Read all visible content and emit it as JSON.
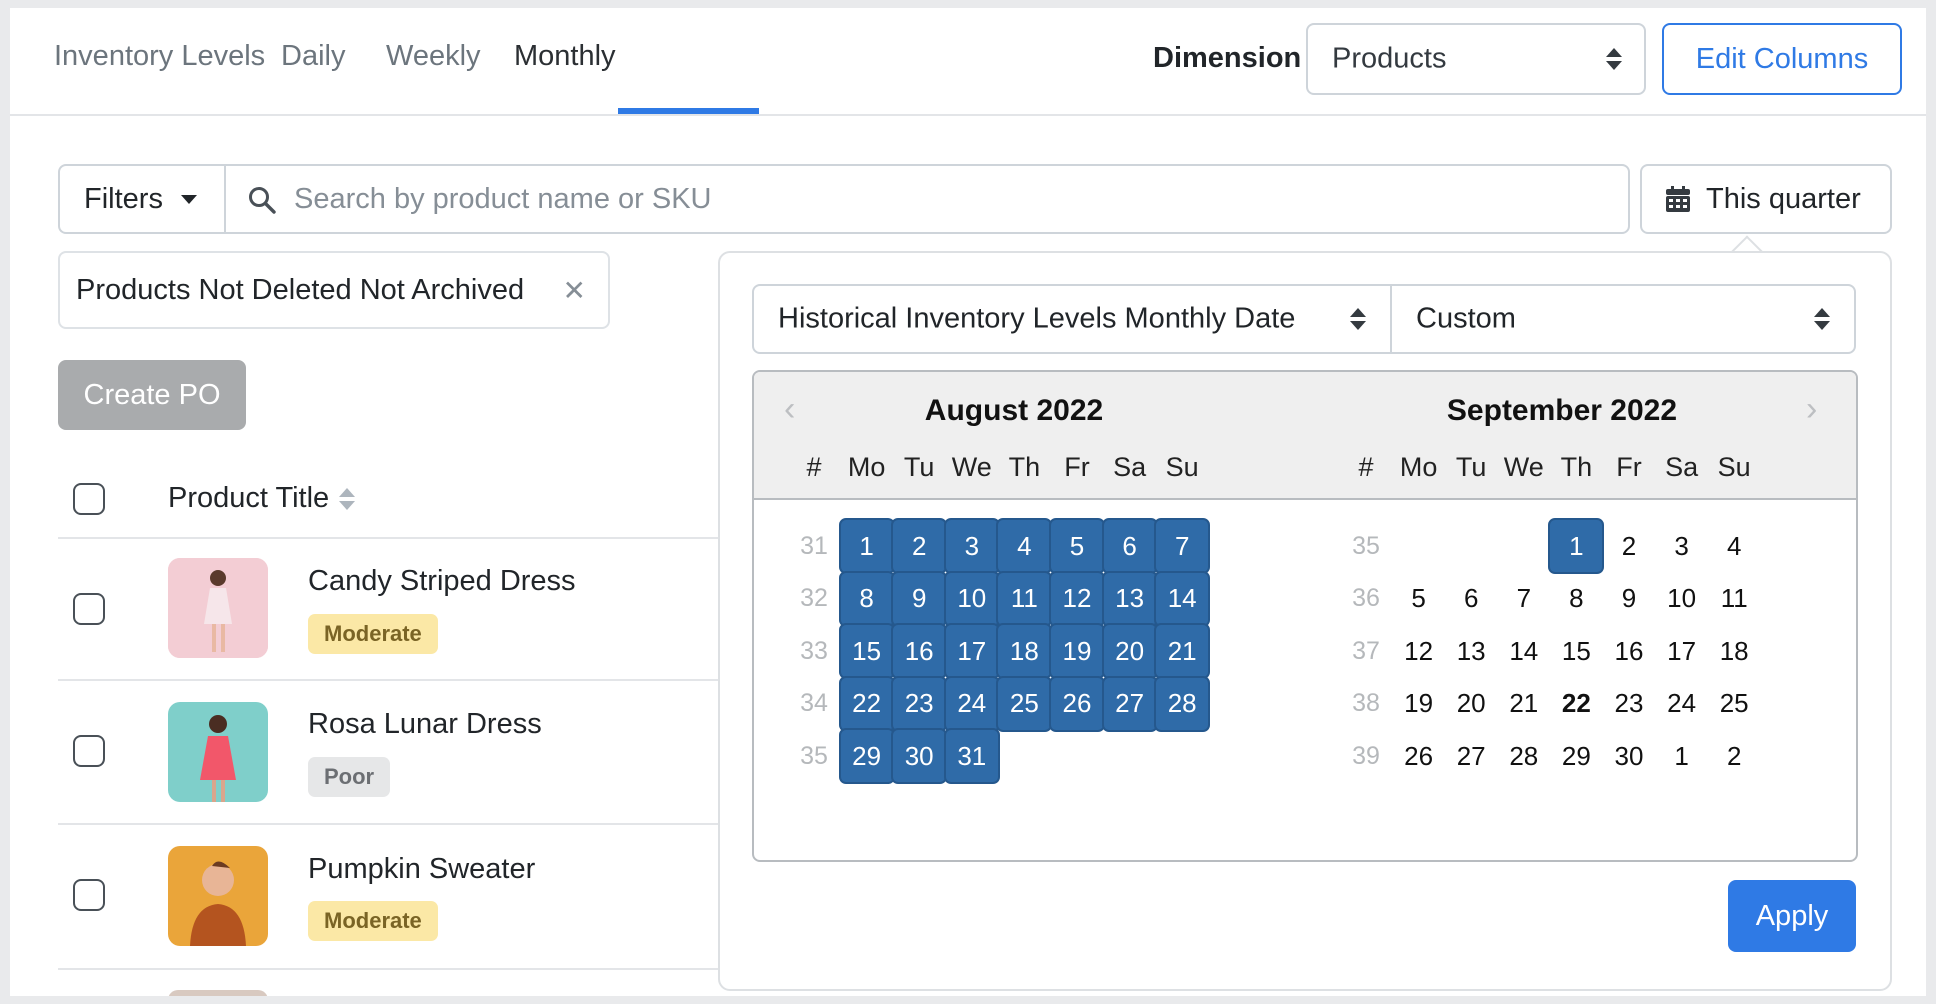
{
  "tabs": [
    "Inventory Levels",
    "Daily",
    "Weekly",
    "Monthly"
  ],
  "active_tab": "Monthly",
  "dimension": {
    "label": "Dimension",
    "value": "Products"
  },
  "edit_columns_label": "Edit Columns",
  "toolbar": {
    "filters_label": "Filters",
    "search_placeholder": "Search by product name or SKU",
    "date_button_label": "This quarter"
  },
  "active_filter_chip": "Products Not Deleted Not Archived",
  "create_po_label": "Create PO",
  "table": {
    "column_header": "Product Title",
    "rows": [
      {
        "name": "Candy Striped Dress",
        "status": "Moderate"
      },
      {
        "name": "Rosa Lunar Dress",
        "status": "Poor"
      },
      {
        "name": "Pumpkin Sweater",
        "status": "Moderate"
      }
    ]
  },
  "date_picker": {
    "field_select": "Historical Inventory Levels Monthly Date",
    "range_select": "Custom",
    "months": [
      {
        "title": "August 2022",
        "weekday_headers": [
          "#",
          "Mo",
          "Tu",
          "We",
          "Th",
          "Fr",
          "Sa",
          "Su"
        ],
        "weeks": [
          {
            "wk": "31",
            "days": [
              "1",
              "2",
              "3",
              "4",
              "5",
              "6",
              "7"
            ]
          },
          {
            "wk": "32",
            "days": [
              "8",
              "9",
              "10",
              "11",
              "12",
              "13",
              "14"
            ]
          },
          {
            "wk": "33",
            "days": [
              "15",
              "16",
              "17",
              "18",
              "19",
              "20",
              "21"
            ]
          },
          {
            "wk": "34",
            "days": [
              "22",
              "23",
              "24",
              "25",
              "26",
              "27",
              "28"
            ]
          },
          {
            "wk": "35",
            "days": [
              "29",
              "30",
              "31",
              "",
              "",
              "",
              ""
            ]
          }
        ]
      },
      {
        "title": "September 2022",
        "weekday_headers": [
          "#",
          "Mo",
          "Tu",
          "We",
          "Th",
          "Fr",
          "Sa",
          "Su"
        ],
        "weeks": [
          {
            "wk": "35",
            "days": [
              "",
              "",
              "",
              "1",
              "2",
              "3",
              "4"
            ]
          },
          {
            "wk": "36",
            "days": [
              "5",
              "6",
              "7",
              "8",
              "9",
              "10",
              "11"
            ]
          },
          {
            "wk": "37",
            "days": [
              "12",
              "13",
              "14",
              "15",
              "16",
              "17",
              "18"
            ]
          },
          {
            "wk": "38",
            "days": [
              "19",
              "20",
              "21",
              "22",
              "23",
              "24",
              "25"
            ]
          },
          {
            "wk": "39",
            "days": [
              "26",
              "27",
              "28",
              "29",
              "30",
              "1",
              "2"
            ]
          }
        ]
      }
    ],
    "selected_range": "August 1, 2022 – September 1, 2022",
    "today": "September 22, 2022",
    "apply_label": "Apply"
  },
  "colors": {
    "accent": "#2f7ae5",
    "selected_day": "#2f6ba8",
    "badge_moderate": "#fbe8a6",
    "badge_poor": "#e6e7e8"
  }
}
